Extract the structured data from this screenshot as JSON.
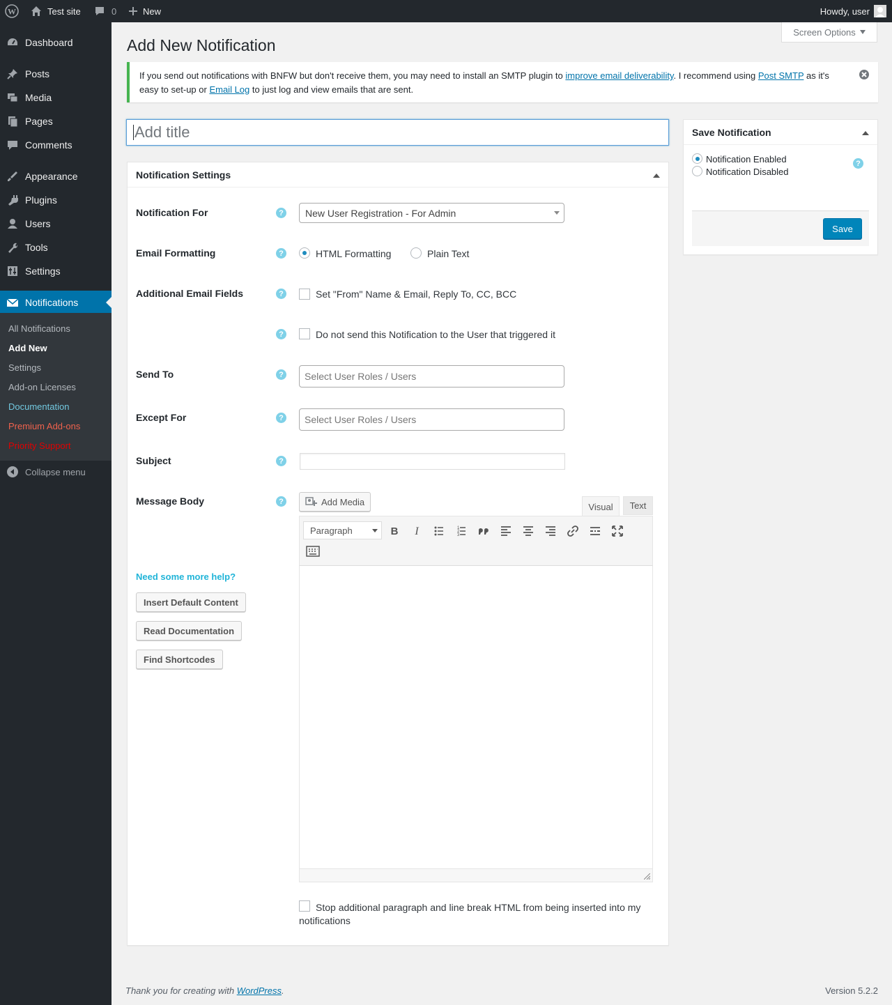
{
  "admin_bar": {
    "site_name": "Test site",
    "comments_count": "0",
    "new_label": "New",
    "howdy": "Howdy, user"
  },
  "sidebar": {
    "items": [
      {
        "label": "Dashboard",
        "icon": "dashboard-icon"
      },
      {
        "label": "Posts",
        "icon": "pushpin-icon"
      },
      {
        "label": "Media",
        "icon": "media-icon"
      },
      {
        "label": "Pages",
        "icon": "pages-icon"
      },
      {
        "label": "Comments",
        "icon": "comments-icon"
      },
      {
        "label": "Appearance",
        "icon": "appearance-icon"
      },
      {
        "label": "Plugins",
        "icon": "plugins-icon"
      },
      {
        "label": "Users",
        "icon": "users-icon"
      },
      {
        "label": "Tools",
        "icon": "tools-icon"
      },
      {
        "label": "Settings",
        "icon": "settings-icon"
      },
      {
        "label": "Notifications",
        "icon": "envelope-icon"
      }
    ],
    "submenu": [
      {
        "label": "All Notifications",
        "color": "#b4b9be"
      },
      {
        "label": "Add New",
        "color": "#ffffff"
      },
      {
        "label": "Settings",
        "color": "#b4b9be"
      },
      {
        "label": "Add-on Licenses",
        "color": "#b4b9be"
      },
      {
        "label": "Documentation",
        "color": "#72c9e0"
      },
      {
        "label": "Premium Add-ons",
        "color": "#f0624d"
      },
      {
        "label": "Priority Support",
        "color": "#e00000"
      }
    ],
    "collapse_label": "Collapse menu"
  },
  "screen_options": "Screen Options",
  "page_title": "Add New Notification",
  "notice": {
    "t1": "If you send out notifications with BNFW but don't receive them, you may need to install an SMTP plugin to ",
    "link1": "improve email deliverability",
    "t2": ". I recommend using ",
    "link2": "Post SMTP",
    "t3": " as it's easy to set-up or ",
    "link3": "Email Log",
    "t4": " to just log and view emails that are sent."
  },
  "title_placeholder": "Add title",
  "settings": {
    "heading": "Notification Settings",
    "notification_for_label": "Notification For",
    "notification_for_value": "New User Registration - For Admin",
    "email_formatting_label": "Email Formatting",
    "html_formatting": "HTML Formatting",
    "plain_text": "Plain Text",
    "additional_fields_label": "Additional Email Fields",
    "additional_fields_option": "Set \"From\" Name & Email, Reply To, CC, BCC",
    "no_send_option": "Do not send this Notification to the User that triggered it",
    "send_to_label": "Send To",
    "send_to_placeholder": "Select User Roles / Users",
    "except_for_label": "Except For",
    "except_for_placeholder": "Select User Roles / Users",
    "subject_label": "Subject",
    "subject_value": "",
    "message_body_label": "Message Body",
    "add_media": "Add Media",
    "tab_visual": "Visual",
    "tab_text": "Text",
    "paragraph_select": "Paragraph",
    "help_heading": "Need some more help?",
    "insert_default": "Insert Default Content",
    "read_docs": "Read Documentation",
    "find_shortcodes": "Find Shortcodes",
    "stop_paragraph": "Stop additional paragraph and line break HTML from being inserted into my notifications"
  },
  "save_box": {
    "heading": "Save Notification",
    "enabled": "Notification Enabled",
    "disabled": "Notification Disabled",
    "save_button": "Save"
  },
  "footer": {
    "thanks": "Thank you for creating with ",
    "wp_link": "WordPress",
    "dot": ".",
    "version": "Version 5.2.2"
  },
  "colors": {
    "accent": "#0073aa",
    "help_icon": "#7fd1e8",
    "notice_border": "#46b450"
  }
}
